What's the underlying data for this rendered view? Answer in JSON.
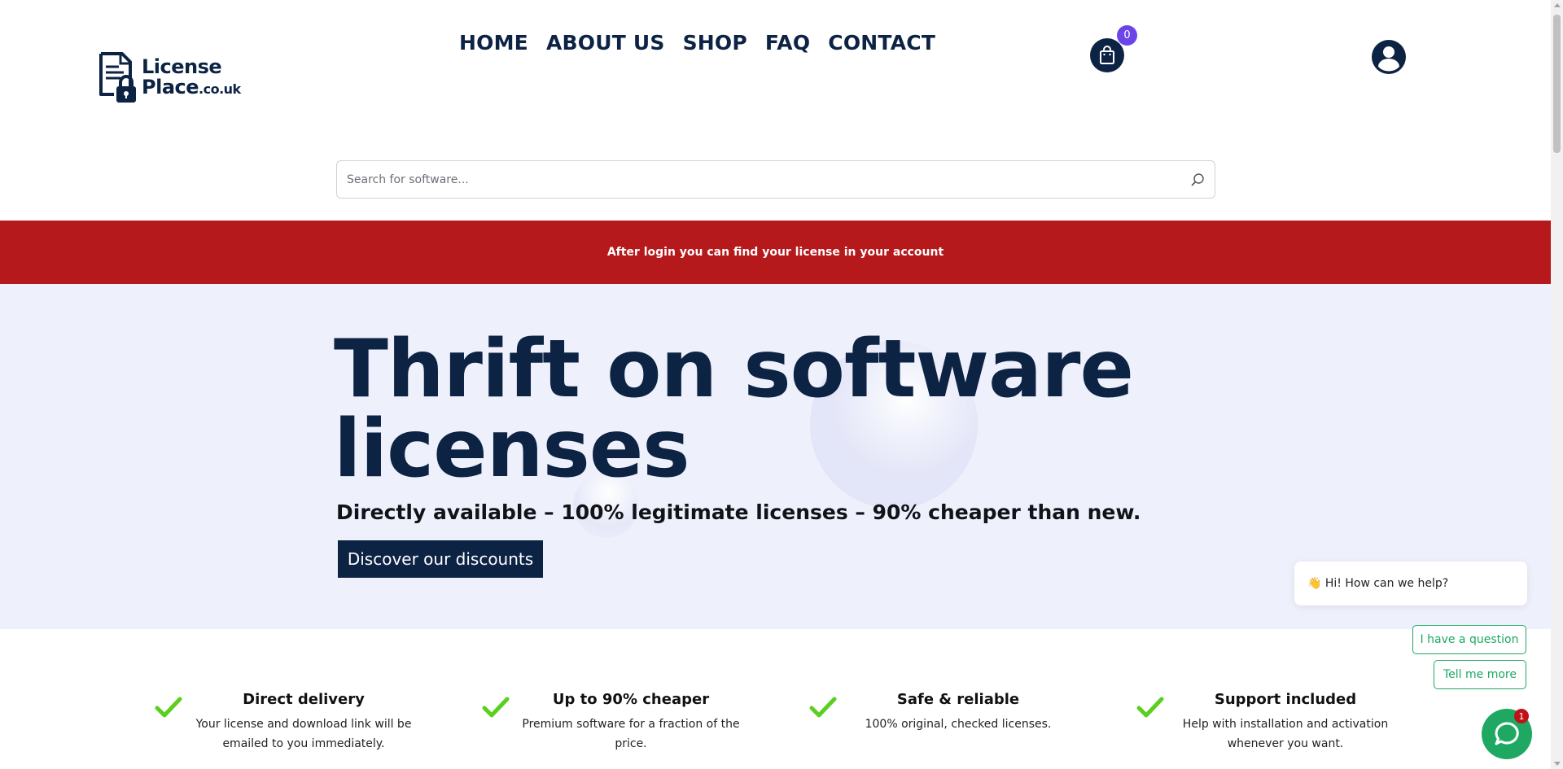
{
  "brand": {
    "logo_line1": "License",
    "logo_line2": "Place",
    "logo_suffix": ".co.uk",
    "icon": "document-lock-icon",
    "primary_color": "#0d2344"
  },
  "nav": {
    "items": [
      {
        "label": "HOME"
      },
      {
        "label": "ABOUT US"
      },
      {
        "label": "SHOP"
      },
      {
        "label": "FAQ"
      },
      {
        "label": "CONTACT"
      }
    ]
  },
  "cart": {
    "icon": "shopping-bag-icon",
    "count": "0",
    "badge_color": "#6c45e8"
  },
  "account": {
    "icon": "user-avatar-icon"
  },
  "search": {
    "placeholder": "Search for software...",
    "value": "",
    "icon": "search-icon"
  },
  "notice": {
    "text": "After login you can find your license in your account",
    "color": "#b5191c"
  },
  "hero": {
    "title_line1": "Thrift on software",
    "title_line2": "licenses",
    "subtitle": "Directly available – 100% legitimate licenses – 90% cheaper than new.",
    "cta_label": "Discover our discounts",
    "background": "#eef0fb"
  },
  "features": [
    {
      "icon": "check-icon",
      "title": "Direct delivery",
      "line1": "Your license and download link will be",
      "line2": "emailed to you immediately."
    },
    {
      "icon": "check-icon",
      "title": "Up to 90% cheaper",
      "line1": "Premium software for a fraction of the",
      "line2": "price."
    },
    {
      "icon": "check-icon",
      "title": "Safe & reliable",
      "line1": "100% original, checked licenses.",
      "line2": ""
    },
    {
      "icon": "check-icon",
      "title": "Support included",
      "line1": "Help with installation and activation",
      "line2": "whenever you want."
    }
  ],
  "chat": {
    "greeting": "👋 Hi! How can we help?",
    "option1": "I have a question",
    "option2": "Tell me more",
    "unread": "1",
    "icon": "chat-icon",
    "color": "#1fa862"
  }
}
